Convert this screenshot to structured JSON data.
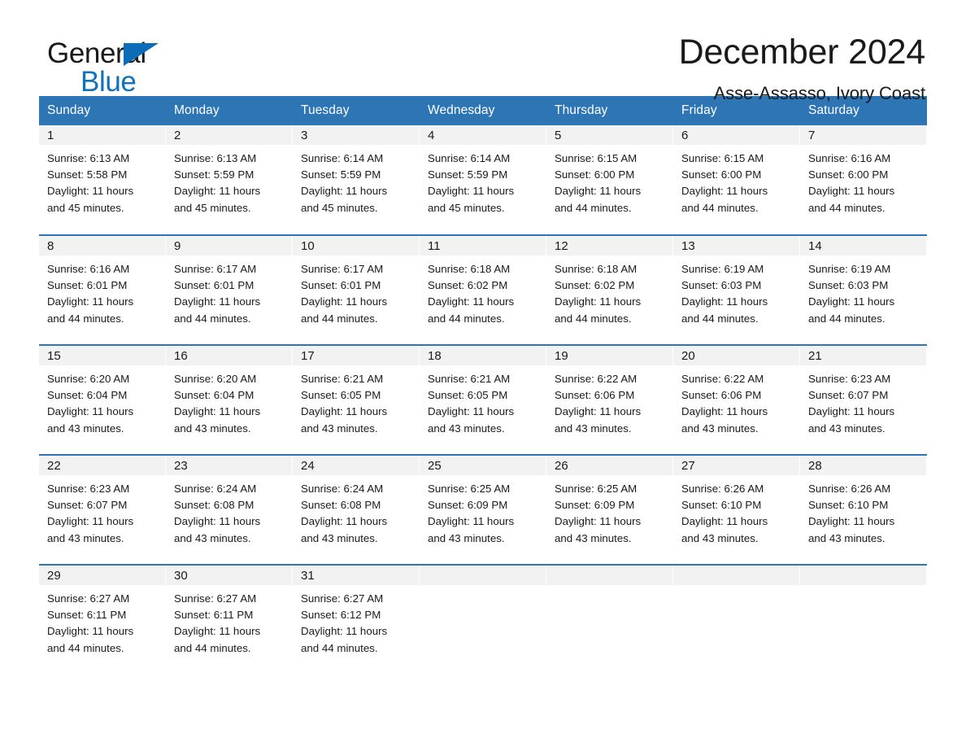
{
  "logo": {
    "text_primary": "General",
    "text_secondary": "Blue",
    "triangle_color": "#0b6cb8",
    "secondary_color": "#1072bb"
  },
  "header": {
    "title": "December 2024",
    "subtitle": "Asse-Assasso, Ivory Coast"
  },
  "theme": {
    "header_bg": "#2e75b6",
    "header_text": "#ffffff",
    "daynum_bg": "#f2f2f2",
    "row_rule": "#2e75b6",
    "page_bg": "#ffffff"
  },
  "weekday_headers": [
    "Sunday",
    "Monday",
    "Tuesday",
    "Wednesday",
    "Thursday",
    "Friday",
    "Saturday"
  ],
  "weeks": [
    {
      "cells": [
        {
          "day": "1",
          "details": "Sunrise: 6:13 AM\nSunset: 5:58 PM\nDaylight: 11 hours\nand 45 minutes."
        },
        {
          "day": "2",
          "details": "Sunrise: 6:13 AM\nSunset: 5:59 PM\nDaylight: 11 hours\nand 45 minutes."
        },
        {
          "day": "3",
          "details": "Sunrise: 6:14 AM\nSunset: 5:59 PM\nDaylight: 11 hours\nand 45 minutes."
        },
        {
          "day": "4",
          "details": "Sunrise: 6:14 AM\nSunset: 5:59 PM\nDaylight: 11 hours\nand 45 minutes."
        },
        {
          "day": "5",
          "details": "Sunrise: 6:15 AM\nSunset: 6:00 PM\nDaylight: 11 hours\nand 44 minutes."
        },
        {
          "day": "6",
          "details": "Sunrise: 6:15 AM\nSunset: 6:00 PM\nDaylight: 11 hours\nand 44 minutes."
        },
        {
          "day": "7",
          "details": "Sunrise: 6:16 AM\nSunset: 6:00 PM\nDaylight: 11 hours\nand 44 minutes."
        }
      ]
    },
    {
      "cells": [
        {
          "day": "8",
          "details": "Sunrise: 6:16 AM\nSunset: 6:01 PM\nDaylight: 11 hours\nand 44 minutes."
        },
        {
          "day": "9",
          "details": "Sunrise: 6:17 AM\nSunset: 6:01 PM\nDaylight: 11 hours\nand 44 minutes."
        },
        {
          "day": "10",
          "details": "Sunrise: 6:17 AM\nSunset: 6:01 PM\nDaylight: 11 hours\nand 44 minutes."
        },
        {
          "day": "11",
          "details": "Sunrise: 6:18 AM\nSunset: 6:02 PM\nDaylight: 11 hours\nand 44 minutes."
        },
        {
          "day": "12",
          "details": "Sunrise: 6:18 AM\nSunset: 6:02 PM\nDaylight: 11 hours\nand 44 minutes."
        },
        {
          "day": "13",
          "details": "Sunrise: 6:19 AM\nSunset: 6:03 PM\nDaylight: 11 hours\nand 44 minutes."
        },
        {
          "day": "14",
          "details": "Sunrise: 6:19 AM\nSunset: 6:03 PM\nDaylight: 11 hours\nand 44 minutes."
        }
      ]
    },
    {
      "cells": [
        {
          "day": "15",
          "details": "Sunrise: 6:20 AM\nSunset: 6:04 PM\nDaylight: 11 hours\nand 43 minutes."
        },
        {
          "day": "16",
          "details": "Sunrise: 6:20 AM\nSunset: 6:04 PM\nDaylight: 11 hours\nand 43 minutes."
        },
        {
          "day": "17",
          "details": "Sunrise: 6:21 AM\nSunset: 6:05 PM\nDaylight: 11 hours\nand 43 minutes."
        },
        {
          "day": "18",
          "details": "Sunrise: 6:21 AM\nSunset: 6:05 PM\nDaylight: 11 hours\nand 43 minutes."
        },
        {
          "day": "19",
          "details": "Sunrise: 6:22 AM\nSunset: 6:06 PM\nDaylight: 11 hours\nand 43 minutes."
        },
        {
          "day": "20",
          "details": "Sunrise: 6:22 AM\nSunset: 6:06 PM\nDaylight: 11 hours\nand 43 minutes."
        },
        {
          "day": "21",
          "details": "Sunrise: 6:23 AM\nSunset: 6:07 PM\nDaylight: 11 hours\nand 43 minutes."
        }
      ]
    },
    {
      "cells": [
        {
          "day": "22",
          "details": "Sunrise: 6:23 AM\nSunset: 6:07 PM\nDaylight: 11 hours\nand 43 minutes."
        },
        {
          "day": "23",
          "details": "Sunrise: 6:24 AM\nSunset: 6:08 PM\nDaylight: 11 hours\nand 43 minutes."
        },
        {
          "day": "24",
          "details": "Sunrise: 6:24 AM\nSunset: 6:08 PM\nDaylight: 11 hours\nand 43 minutes."
        },
        {
          "day": "25",
          "details": "Sunrise: 6:25 AM\nSunset: 6:09 PM\nDaylight: 11 hours\nand 43 minutes."
        },
        {
          "day": "26",
          "details": "Sunrise: 6:25 AM\nSunset: 6:09 PM\nDaylight: 11 hours\nand 43 minutes."
        },
        {
          "day": "27",
          "details": "Sunrise: 6:26 AM\nSunset: 6:10 PM\nDaylight: 11 hours\nand 43 minutes."
        },
        {
          "day": "28",
          "details": "Sunrise: 6:26 AM\nSunset: 6:10 PM\nDaylight: 11 hours\nand 43 minutes."
        }
      ]
    },
    {
      "cells": [
        {
          "day": "29",
          "details": "Sunrise: 6:27 AM\nSunset: 6:11 PM\nDaylight: 11 hours\nand 44 minutes."
        },
        {
          "day": "30",
          "details": "Sunrise: 6:27 AM\nSunset: 6:11 PM\nDaylight: 11 hours\nand 44 minutes."
        },
        {
          "day": "31",
          "details": "Sunrise: 6:27 AM\nSunset: 6:12 PM\nDaylight: 11 hours\nand 44 minutes."
        },
        {
          "day": "",
          "details": ""
        },
        {
          "day": "",
          "details": ""
        },
        {
          "day": "",
          "details": ""
        },
        {
          "day": "",
          "details": ""
        }
      ]
    }
  ]
}
